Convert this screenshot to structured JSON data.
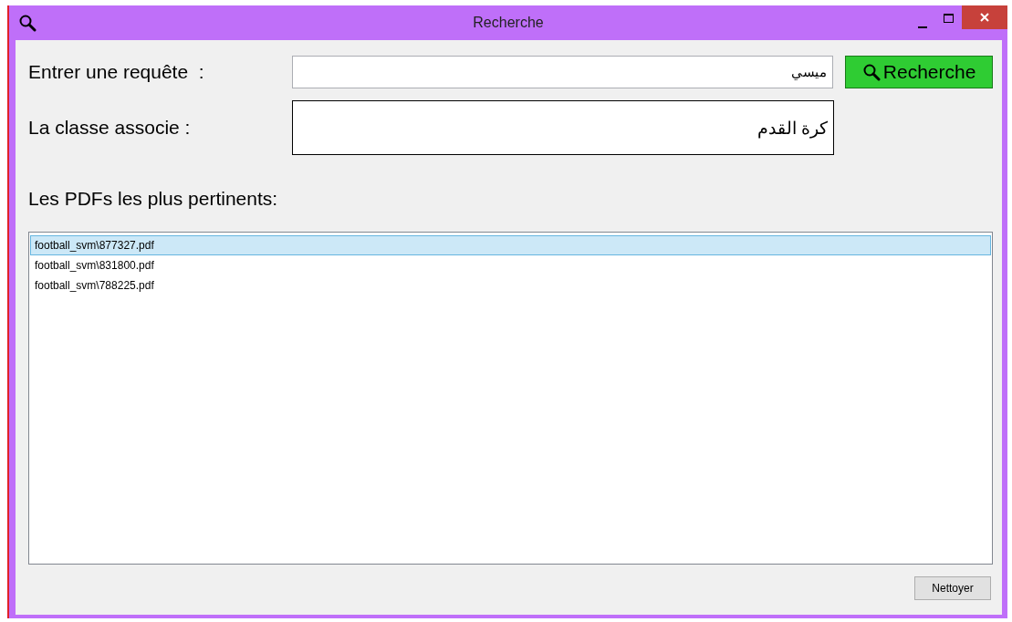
{
  "window": {
    "title": "Recherche"
  },
  "query": {
    "label": "Entrer une requête  :",
    "value": "ميسي"
  },
  "search_button": {
    "label": "Recherche"
  },
  "class_field": {
    "label": "La classe associe :",
    "value": "كرة القدم"
  },
  "results": {
    "label": "Les PDFs les plus pertinents:",
    "items": [
      {
        "text": "football_svm\\877327.pdf",
        "selected": true
      },
      {
        "text": "football_svm\\831800.pdf",
        "selected": false
      },
      {
        "text": "football_svm\\788225.pdf",
        "selected": false
      }
    ]
  },
  "clear_button": {
    "label": "Nettoyer"
  }
}
